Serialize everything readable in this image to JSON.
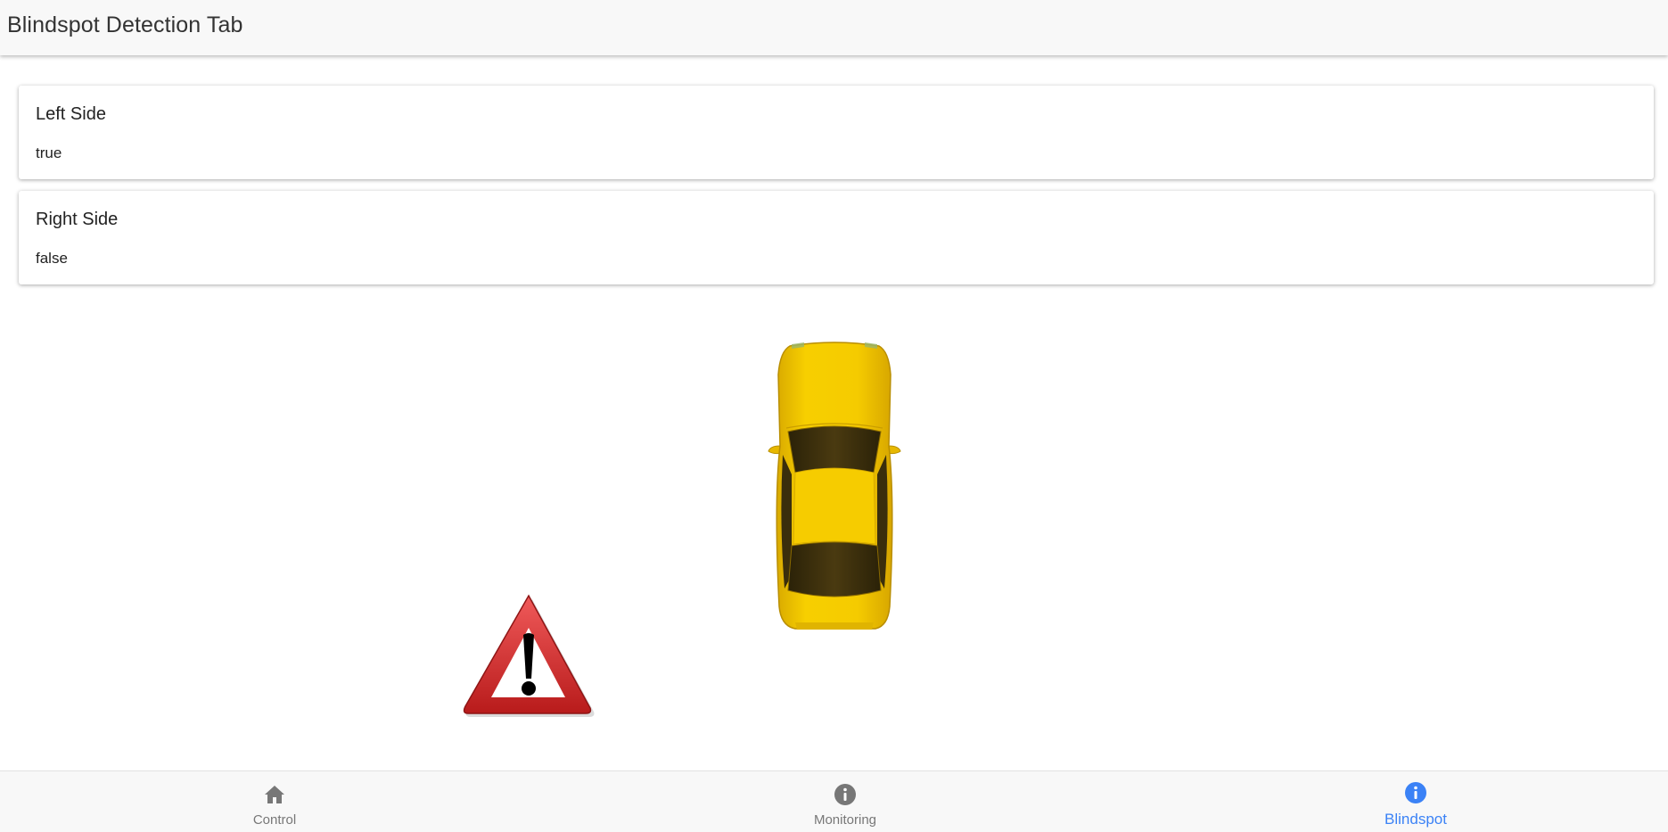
{
  "header": {
    "title": "Blindspot Detection Tab"
  },
  "cards": {
    "left": {
      "title": "Left Side",
      "value": "true"
    },
    "right": {
      "title": "Right Side",
      "value": "false"
    }
  },
  "scene": {
    "car_icon": "car-top-view-icon",
    "warning_icon": "warning-triangle-icon",
    "warning_side": "left"
  },
  "tabs": {
    "control": {
      "label": "Control",
      "icon": "home-icon"
    },
    "monitoring": {
      "label": "Monitoring",
      "icon": "info-icon"
    },
    "blindspot": {
      "label": "Blindspot",
      "icon": "info-icon",
      "active": true
    }
  },
  "colors": {
    "active_tab": "#3b82f6",
    "inactive_tab": "#777777",
    "car_body": "#f2c500",
    "warning_red": "#d62a2a"
  }
}
